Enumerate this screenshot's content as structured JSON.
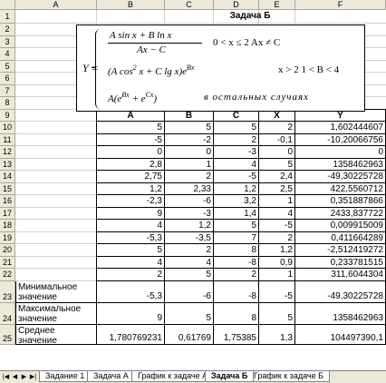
{
  "columns": [
    "A",
    "B",
    "C",
    "D",
    "E",
    "F"
  ],
  "rows": [
    "1",
    "2",
    "3",
    "4",
    "5",
    "6",
    "7",
    "8",
    "9",
    "10",
    "11",
    "12",
    "13",
    "14",
    "15",
    "16",
    "17",
    "18",
    "19",
    "20",
    "21",
    "22",
    "23",
    "24",
    "25"
  ],
  "title": "Задача Б",
  "formula": {
    "lhs": "Y =",
    "case1_num": "A sin  x + B  ln  x",
    "case1_den": "Ax − C",
    "case1_cond": "0 < x ≤ 2  Ax ≠ C",
    "case2_expr": "(A cos",
    "case2_sup1": "2",
    "case2_mid": " x + C lg  x)e",
    "case2_sup2": "Bx",
    "case2_cond": "x > 2     1 < B < 4",
    "case3_expr": "A(e",
    "case3_sup1": "Bx",
    "case3_mid": " + e",
    "case3_sup2": "Cx",
    "case3_end": ")",
    "case3_cond": "в остальных  случаях"
  },
  "table": {
    "headers": [
      "A",
      "B",
      "C",
      "X",
      "Y"
    ],
    "rows": [
      [
        "5",
        "5",
        "5",
        "2",
        "1,602444607"
      ],
      [
        "-5",
        "-2",
        "2",
        "-0,1",
        "-10,20066756"
      ],
      [
        "0",
        "0",
        "-3",
        "0",
        "0"
      ],
      [
        "2,8",
        "1",
        "4",
        "5",
        "1358462963"
      ],
      [
        "2,75",
        "2",
        "-5",
        "2,4",
        "-49,30225728"
      ],
      [
        "1,2",
        "2,33",
        "1,2",
        "2,5",
        "422,5560712"
      ],
      [
        "-2,3",
        "-6",
        "3,2",
        "1",
        "0,351887866"
      ],
      [
        "9",
        "-3",
        "1,4",
        "4",
        "2433,837722"
      ],
      [
        "4",
        "1,2",
        "5",
        "-5",
        "0,009915009"
      ],
      [
        "-5,3",
        "-3,5",
        "7",
        "2",
        "0,411664289"
      ],
      [
        "5",
        "2",
        "8",
        "1,2",
        "-2,512419272"
      ],
      [
        "4",
        "4",
        "-8",
        "0,9",
        "0,233781515"
      ],
      [
        "2",
        "5",
        "2",
        "1",
        "311,6044304"
      ]
    ],
    "min_label": "Минимальное значение",
    "min_values": [
      "-5,3",
      "-6",
      "-8",
      "-5",
      "-49,30225728"
    ],
    "max_label": "Максимальное значение",
    "max_values": [
      "9",
      "5",
      "8",
      "5",
      "1358462963"
    ],
    "avg_label": "Среднее значение",
    "avg_values": [
      "1,780769231",
      "0,61769",
      "1,75385",
      "1,3",
      "104497390,1"
    ]
  },
  "tabs": [
    "Задание 1",
    "Задача А",
    "График к задаче А",
    "Задача Б",
    "График к задаче Б"
  ],
  "active_tab": "Задача Б"
}
